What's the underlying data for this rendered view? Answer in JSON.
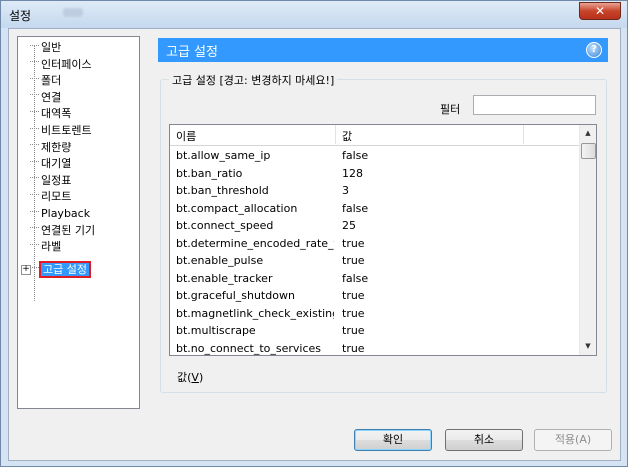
{
  "window": {
    "title": "설정"
  },
  "sidebar": {
    "items": [
      {
        "label": "일반"
      },
      {
        "label": "인터페이스"
      },
      {
        "label": "폴더"
      },
      {
        "label": "연결"
      },
      {
        "label": "대역폭"
      },
      {
        "label": "비트토렌트"
      },
      {
        "label": "제한량"
      },
      {
        "label": "대기열"
      },
      {
        "label": "일정표"
      },
      {
        "label": "리모트"
      },
      {
        "label": "Playback"
      },
      {
        "label": "연결된 기기"
      },
      {
        "label": "라벨"
      },
      {
        "label": "고급 설정",
        "selected": true
      }
    ]
  },
  "panel": {
    "title": "고급 설정",
    "group_title": "고급 설정 [경고: 변경하지 마세요!]",
    "filter_label": "필터",
    "filter_value": "",
    "columns": {
      "name": "이름",
      "value": "값"
    },
    "rows": [
      {
        "name": "bt.allow_same_ip",
        "value": "false"
      },
      {
        "name": "bt.ban_ratio",
        "value": "128"
      },
      {
        "name": "bt.ban_threshold",
        "value": "3"
      },
      {
        "name": "bt.compact_allocation",
        "value": "false"
      },
      {
        "name": "bt.connect_speed",
        "value": "25"
      },
      {
        "name": "bt.determine_encoded_rate_fo...",
        "value": "true"
      },
      {
        "name": "bt.enable_pulse",
        "value": "true"
      },
      {
        "name": "bt.enable_tracker",
        "value": "false"
      },
      {
        "name": "bt.graceful_shutdown",
        "value": "true"
      },
      {
        "name": "bt.magnetlink_check_existing_...",
        "value": "true"
      },
      {
        "name": "bt.multiscrape",
        "value": "true"
      },
      {
        "name": "bt.no_connect_to_services",
        "value": "true"
      }
    ],
    "value_label": "값(",
    "value_accel": "V",
    "value_label_end": ")"
  },
  "buttons": {
    "ok": "확인",
    "cancel": "취소",
    "apply": "적용(A)"
  },
  "colors": {
    "accent": "#3399ff",
    "highlight_border": "#e01b24"
  }
}
